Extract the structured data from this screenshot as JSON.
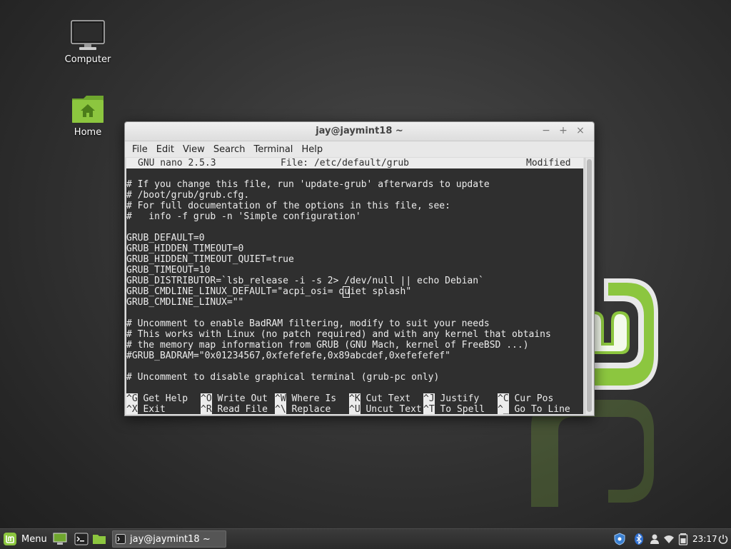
{
  "desktop": {
    "icons": [
      {
        "label": "Computer"
      },
      {
        "label": "Home"
      }
    ]
  },
  "window": {
    "title": "jay@jaymint18 ~",
    "controls": {
      "minimize": "−",
      "maximize": "+",
      "close": "×"
    },
    "menu": [
      "File",
      "Edit",
      "View",
      "Search",
      "Terminal",
      "Help"
    ]
  },
  "nano": {
    "app": "GNU nano 2.5.3",
    "file": "File: /etc/default/grub",
    "status": "Modified",
    "lines": [
      "",
      "# If you change this file, run 'update-grub' afterwards to update",
      "# /boot/grub/grub.cfg.",
      "# For full documentation of the options in this file, see:",
      "#   info -f grub -n 'Simple configuration'",
      "",
      "GRUB_DEFAULT=0",
      "GRUB_HIDDEN_TIMEOUT=0",
      "GRUB_HIDDEN_TIMEOUT_QUIET=true",
      "GRUB_TIMEOUT=10",
      "GRUB_DISTRIBUTOR=`lsb_release -i -s 2> /dev/null || echo Debian`",
      "GRUB_CMDLINE_LINUX_DEFAULT=\"acpi_osi= quiet splash\"",
      "GRUB_CMDLINE_LINUX=\"\"",
      "",
      "# Uncomment to enable BadRAM filtering, modify to suit your needs",
      "# This works with Linux (no patch required) and with any kernel that obtains",
      "# the memory map information from GRUB (GNU Mach, kernel of FreeBSD ...)",
      "#GRUB_BADRAM=\"0x01234567,0xfefefefe,0x89abcdef,0xefefefef\"",
      "",
      "# Uncomment to disable graphical terminal (grub-pc only)"
    ],
    "shortcuts": [
      {
        "key": "^G",
        "label": "Get Help"
      },
      {
        "key": "^O",
        "label": "Write Out"
      },
      {
        "key": "^W",
        "label": "Where Is"
      },
      {
        "key": "^K",
        "label": "Cut Text"
      },
      {
        "key": "^J",
        "label": "Justify"
      },
      {
        "key": "^C",
        "label": "Cur Pos"
      },
      {
        "key": "^X",
        "label": "Exit"
      },
      {
        "key": "^R",
        "label": "Read File"
      },
      {
        "key": "^\\",
        "label": "Replace"
      },
      {
        "key": "^U",
        "label": "Uncut Text"
      },
      {
        "key": "^T",
        "label": "To Spell"
      },
      {
        "key": "^_",
        "label": "Go To Line"
      }
    ]
  },
  "taskbar": {
    "menu_label": "Menu",
    "task_label": "jay@jaymint18 ~",
    "clock": "23:17"
  },
  "icons": {
    "menu": "mint-logo-icon",
    "show-desktop": "desktop-icon",
    "terminal": "terminal-icon",
    "files": "folder-icon",
    "tray": [
      "shield-icon",
      "bluetooth-icon",
      "user-icon",
      "wifi-icon",
      "battery-icon",
      "power-icon"
    ]
  },
  "colors": {
    "mint_green": "#8cc63f",
    "terminal_bg": "#2f2f2f",
    "terminal_fg": "#ececec"
  }
}
